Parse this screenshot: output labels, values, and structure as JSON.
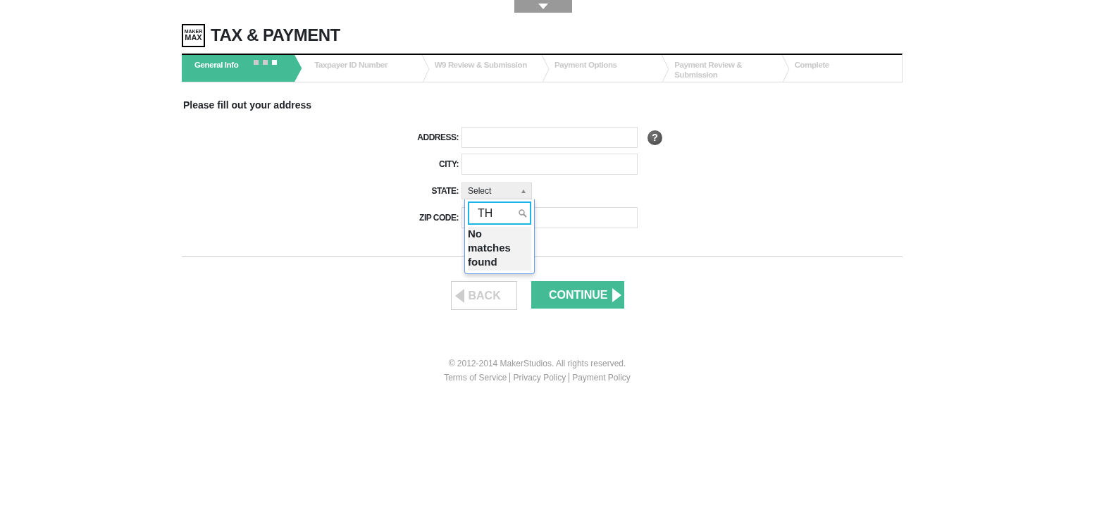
{
  "logo": {
    "line_1": "MAKER",
    "line_2": "MAX"
  },
  "title": "TAX & PAYMENT",
  "steps": [
    {
      "label": "General Info",
      "selected": true
    },
    {
      "label": "Taxpayer ID Number",
      "selected": false
    },
    {
      "label": "W9 Review & Submission",
      "selected": false
    },
    {
      "label": "Payment Options",
      "selected": false
    },
    {
      "label": "Payment Review & Submission",
      "selected": false
    },
    {
      "label": "Complete",
      "selected": false
    }
  ],
  "heading": "Please fill out your address",
  "fields": [
    {
      "kind": "text",
      "label": "ADDRESS:",
      "help": "?"
    },
    {
      "kind": "text",
      "label": "CITY:"
    },
    {
      "kind": "select",
      "label": "STATE:",
      "value": "Select",
      "expanded": true,
      "search": "TH",
      "message": "No matches found"
    },
    {
      "kind": "text",
      "label": "ZIP CODE:"
    }
  ],
  "buttons": [
    {
      "kind": "back",
      "label": "BACK",
      "disabled": true
    },
    {
      "kind": "continue",
      "label": "CONTINUE",
      "disabled": false
    }
  ],
  "footer": {
    "copyright": "© 2012-2014 MakerStudios. All rights reserved.",
    "links": [
      "Terms of Service",
      "Privacy Policy",
      "Payment Policy"
    ]
  }
}
